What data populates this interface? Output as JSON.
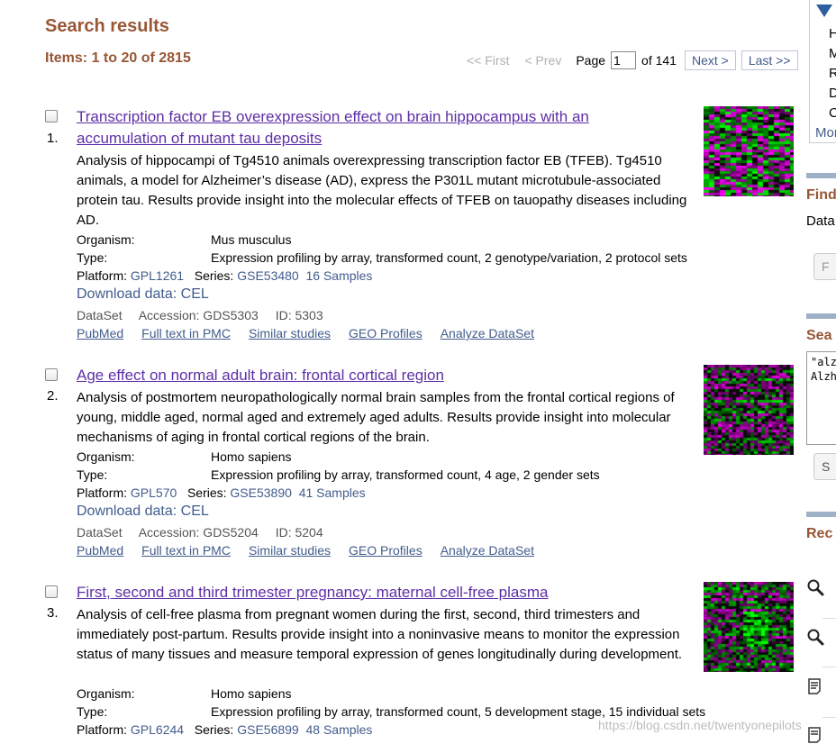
{
  "header": {
    "title": "Search results",
    "items": "Items: 1 to 20 of 2815"
  },
  "pager": {
    "first": "<< First",
    "prev": "< Prev",
    "page_label": "Page",
    "page_value": "1",
    "of_label": "of 141",
    "next": "Next >",
    "last": "Last >>"
  },
  "results": [
    {
      "num": "1.",
      "title": "Transcription factor EB overexpression effect on brain hippocampus with an accumulation of mutant tau deposits",
      "desc": "Analysis of hippocampi of Tg4510 animals overexpressing transcription factor EB (TFEB). Tg4510 animals, a model for Alzheimer’s disease (AD), express the P301L mutant microtubule-associated protein tau. Results provide insight into the molecular effects of TFEB on tauopathy diseases including AD.",
      "organism_label": "Organism:",
      "organism": "Mus musculus",
      "type_label": "Type:",
      "type": "Expression profiling by array, transformed count, 2 genotype/variation, 2 protocol sets",
      "platform_label": "Platform:",
      "platform": "GPL1261",
      "series_label": "Series:",
      "series": "GSE53480",
      "samples": "16 Samples",
      "download": "Download data: CEL",
      "ds_kind": "DataSet",
      "accession": "Accession: GDS5303",
      "id": "ID: 5303",
      "links": [
        "PubMed",
        "Full text in PMC",
        "Similar studies",
        "GEO Profiles",
        "Analyze DataSet"
      ]
    },
    {
      "num": "2.",
      "title": "Age effect on normal adult brain: frontal cortical region",
      "desc": "Analysis of postmortem neuropathologically normal brain samples from the frontal cortical regions of young, middle aged, normal aged and extremely aged adults. Results provide insight into molecular mechanisms of aging in frontal cortical regions of the brain.",
      "organism_label": "Organism:",
      "organism": "Homo sapiens",
      "type_label": "Type:",
      "type": "Expression profiling by array, transformed count, 4 age, 2 gender sets",
      "platform_label": "Platform:",
      "platform": "GPL570",
      "series_label": "Series:",
      "series": "GSE53890",
      "samples": "41 Samples",
      "download": "Download data: CEL",
      "ds_kind": "DataSet",
      "accession": "Accession: GDS5204",
      "id": "ID: 5204",
      "links": [
        "PubMed",
        "Full text in PMC",
        "Similar studies",
        "GEO Profiles",
        "Analyze DataSet"
      ]
    },
    {
      "num": "3.",
      "title": "First, second and third trimester pregnancy: maternal cell-free plasma",
      "desc": "Analysis of cell-free plasma from pregnant women during the first, second, third trimesters and immediately post-partum. Results provide insight into a noninvasive means to monitor the expression status of many tissues and measure temporal expression of genes longitudinally during development.",
      "organism_label": "Organism:",
      "organism": "Homo sapiens",
      "type_label": "Type:",
      "type": "Expression profiling by array, transformed count, 5 development stage, 15 individual sets",
      "platform_label": "Platform:",
      "platform": "GPL6244",
      "series_label": "Series:",
      "series": "GSE56899",
      "samples": "48 Samples"
    }
  ],
  "sidebar": {
    "letters": [
      "H",
      "M",
      "R",
      "D",
      "C"
    ],
    "more": "Mor",
    "find_head": "Find",
    "find_text": "Data",
    "find_btn": "F",
    "search_head": "Sea",
    "search_text": "\"alz\nAlzh",
    "search_btn": "S",
    "recent_head": "Rec"
  },
  "watermark": "https://blog.csdn.net/twentyonepilots",
  "colors": {
    "accent_brown": "#985735",
    "link_blue": "#425c8c",
    "visited_purple": "#5e2ea6"
  }
}
